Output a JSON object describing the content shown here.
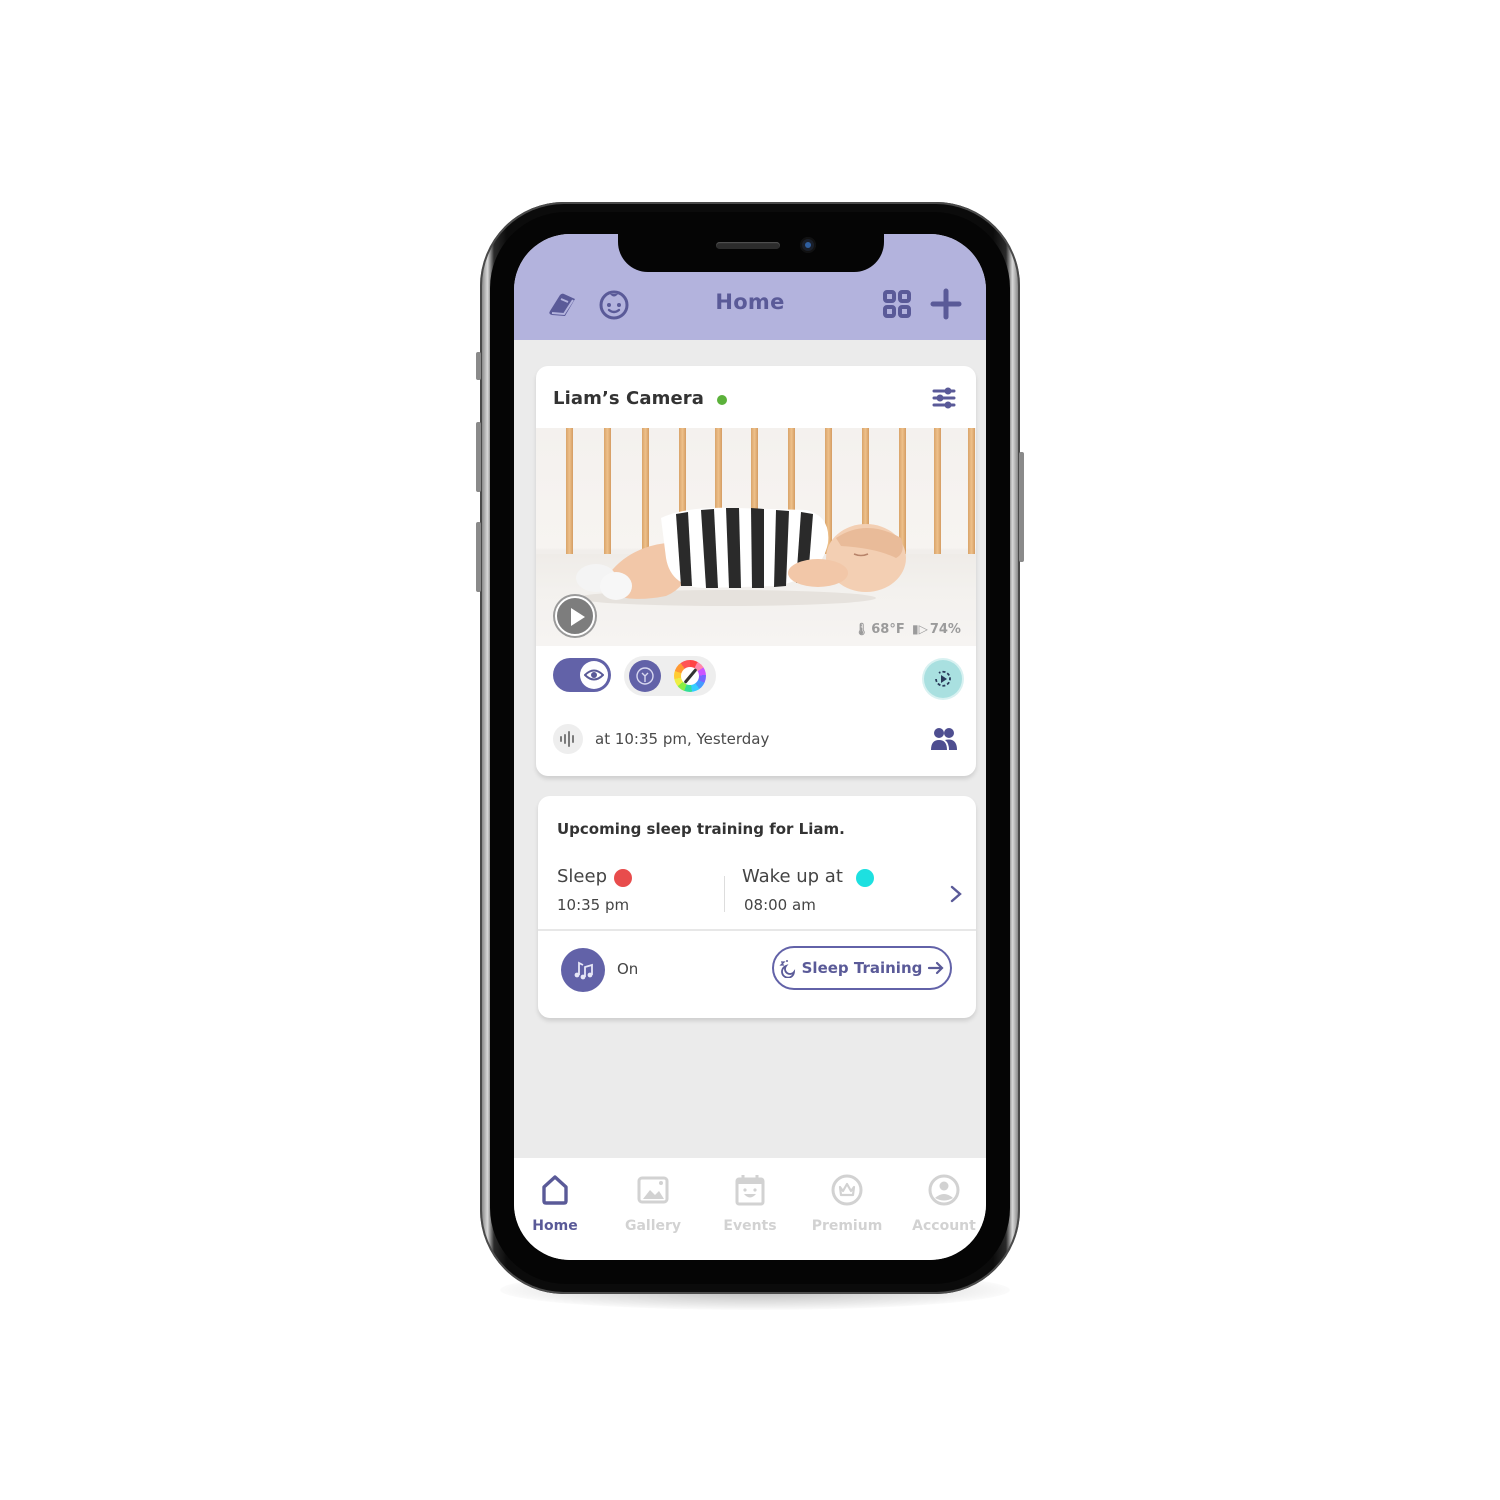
{
  "header": {
    "title": "Home",
    "icons": [
      "guide-book-icon",
      "baby-profile-icon",
      "grid-view-icon",
      "add-icon"
    ]
  },
  "camera_card": {
    "name": "Liam’s Camera",
    "status": "online",
    "status_color": "#5bb13a",
    "temperature": "68°F",
    "battery": "74%",
    "night_vision_on": true,
    "last_event": "at 10:35 pm, Yesterday"
  },
  "training_card": {
    "title": "Upcoming sleep training for Liam.",
    "sleep_label": "Sleep",
    "sleep_time": "10:35 pm",
    "sleep_color": "#e84c4c",
    "wake_label": "Wake up at",
    "wake_time": "08:00 am",
    "wake_color": "#1de0e0",
    "music_state": "On",
    "button_label": "Sleep Training"
  },
  "bottom_nav": {
    "items": [
      {
        "label": "Home",
        "active": true
      },
      {
        "label": "Gallery",
        "active": false
      },
      {
        "label": "Events",
        "active": false
      },
      {
        "label": "Premium",
        "active": false
      },
      {
        "label": "Account",
        "active": false
      }
    ]
  },
  "colors": {
    "accent": "#6262a8",
    "header_bg": "#b3b3dd",
    "screen_bg": "#ebebeb"
  }
}
